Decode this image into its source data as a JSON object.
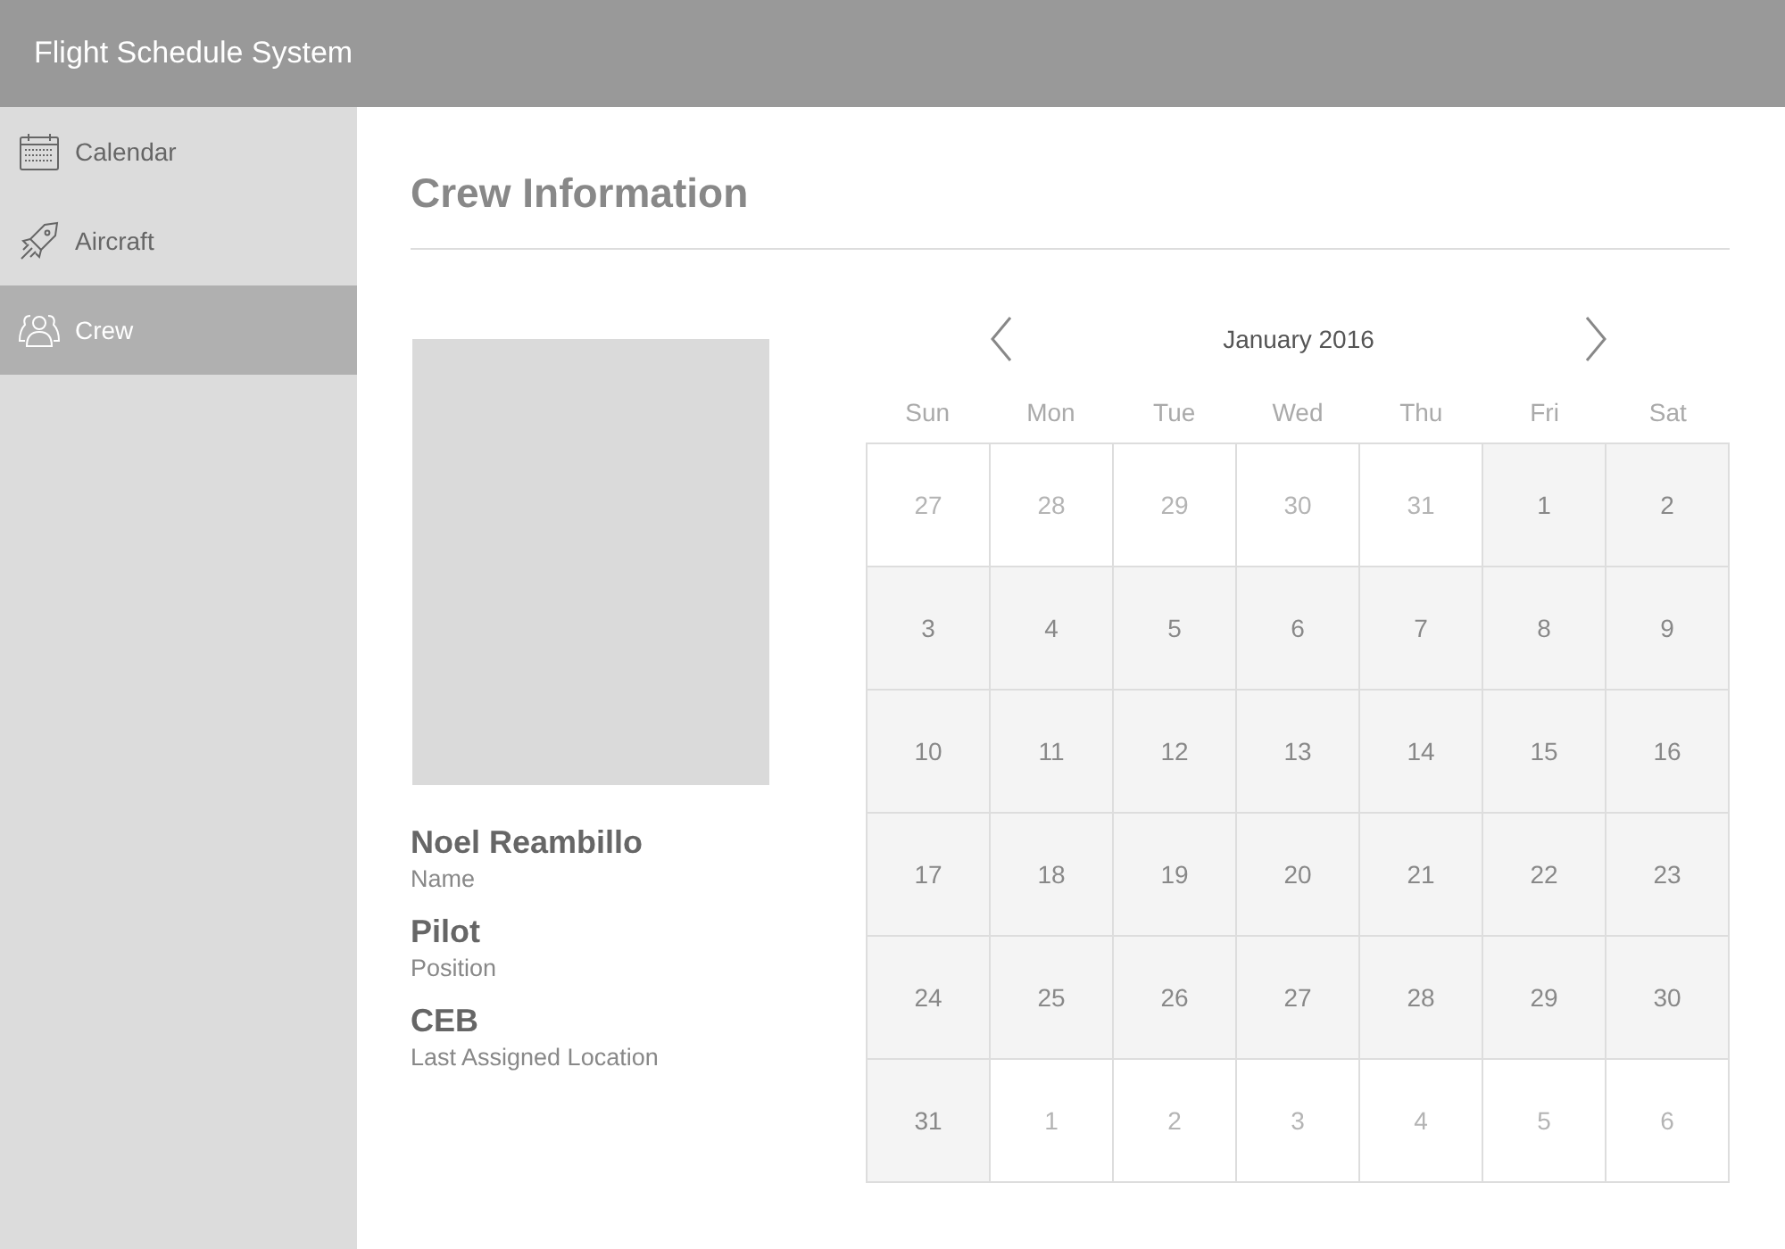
{
  "header": {
    "title": "Flight Schedule System"
  },
  "sidebar": {
    "items": [
      {
        "label": "Calendar",
        "kind": "calendar",
        "selected": false
      },
      {
        "label": "Aircraft",
        "kind": "rocket",
        "selected": false
      },
      {
        "label": "Crew",
        "kind": "people",
        "selected": true
      }
    ]
  },
  "page": {
    "title": "Crew Information"
  },
  "profile": {
    "fields": [
      {
        "value": "Noel Reambillo",
        "label": "Name"
      },
      {
        "value": "Pilot",
        "label": "Position"
      },
      {
        "value": "CEB",
        "label": "Last Assigned Location"
      }
    ]
  },
  "calendar": {
    "month": "January 2016",
    "weekdays": [
      "Sun",
      "Mon",
      "Tue",
      "Wed",
      "Thu",
      "Fri",
      "Sat"
    ],
    "weeks": [
      [
        {
          "day": "27",
          "in_month": false
        },
        {
          "day": "28",
          "in_month": false
        },
        {
          "day": "29",
          "in_month": false
        },
        {
          "day": "30",
          "in_month": false
        },
        {
          "day": "31",
          "in_month": false
        },
        {
          "day": "1",
          "in_month": true
        },
        {
          "day": "2",
          "in_month": true
        }
      ],
      [
        {
          "day": "3",
          "in_month": true
        },
        {
          "day": "4",
          "in_month": true
        },
        {
          "day": "5",
          "in_month": true
        },
        {
          "day": "6",
          "in_month": true
        },
        {
          "day": "7",
          "in_month": true
        },
        {
          "day": "8",
          "in_month": true
        },
        {
          "day": "9",
          "in_month": true
        }
      ],
      [
        {
          "day": "10",
          "in_month": true
        },
        {
          "day": "11",
          "in_month": true
        },
        {
          "day": "12",
          "in_month": true
        },
        {
          "day": "13",
          "in_month": true
        },
        {
          "day": "14",
          "in_month": true
        },
        {
          "day": "15",
          "in_month": true
        },
        {
          "day": "16",
          "in_month": true
        }
      ],
      [
        {
          "day": "17",
          "in_month": true
        },
        {
          "day": "18",
          "in_month": true
        },
        {
          "day": "19",
          "in_month": true
        },
        {
          "day": "20",
          "in_month": true
        },
        {
          "day": "21",
          "in_month": true
        },
        {
          "day": "22",
          "in_month": true
        },
        {
          "day": "23",
          "in_month": true
        }
      ],
      [
        {
          "day": "24",
          "in_month": true
        },
        {
          "day": "25",
          "in_month": true
        },
        {
          "day": "26",
          "in_month": true
        },
        {
          "day": "27",
          "in_month": true
        },
        {
          "day": "28",
          "in_month": true
        },
        {
          "day": "29",
          "in_month": true
        },
        {
          "day": "30",
          "in_month": true
        }
      ],
      [
        {
          "day": "31",
          "in_month": true
        },
        {
          "day": "1",
          "in_month": false
        },
        {
          "day": "2",
          "in_month": false
        },
        {
          "day": "3",
          "in_month": false
        },
        {
          "day": "4",
          "in_month": false
        },
        {
          "day": "5",
          "in_month": false
        },
        {
          "day": "6",
          "in_month": false
        }
      ]
    ]
  }
}
